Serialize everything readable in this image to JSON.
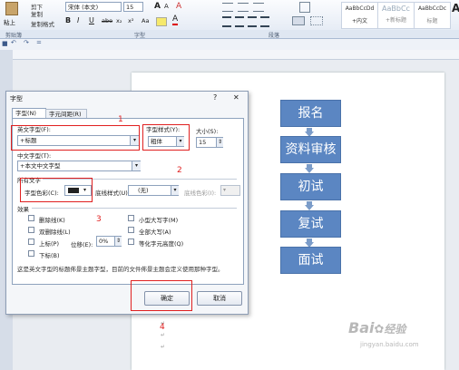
{
  "ribbon": {
    "paste_label": "粘上",
    "cut_label": "剪下",
    "copy_label": "复制",
    "format_painter_label": "复制格式",
    "font_name": "宋体 (本文)",
    "font_size": "15",
    "bold": "B",
    "italic": "I",
    "underline": "U",
    "strike": "abe",
    "subscript": "x₂",
    "superscript": "x²",
    "change_case": "Aa",
    "font_color_a": "A",
    "grow_font": "A",
    "shrink_font": "A",
    "clear_format": "A",
    "styles": [
      "AaBbCcDd",
      "AaBbCc",
      "AaBbCcDc",
      "A"
    ],
    "style_names": [
      "+内文",
      "+新标题",
      "标题",
      ""
    ],
    "groups": [
      "剪贴簿",
      "字型",
      "段落",
      ""
    ]
  },
  "qat": {
    "save": "■",
    "undo": "↶",
    "redo": "↷",
    "more": "="
  },
  "flow": {
    "steps": [
      "报名",
      "资料审核",
      "初试",
      "复试",
      "面试"
    ],
    "colors": {
      "box": "#5b86c2",
      "arrow": "#7b9cc9"
    }
  },
  "dialog": {
    "title": "字型",
    "help": "?",
    "close": "✕",
    "tabs": [
      "字型(N)",
      "字元间距(R)"
    ],
    "western_font_label": "英文字型(F):",
    "western_font_value": "+标题",
    "style_label": "字型样式(Y):",
    "style_value": "粗体",
    "size_label": "大小(S):",
    "size_value": "15",
    "asian_font_label": "中文字型(T):",
    "asian_font_value": "+本文中文字型",
    "all_text_label": "所有文字",
    "font_color_label": "字型色彩(C):",
    "underline_style_label": "底线样式(U):",
    "underline_style_value": "(无)",
    "underline_color_label": "底线色彩(I):",
    "effects_label": "效果",
    "effects_left": [
      "删除线(K)",
      "双删除线(L)",
      "上标(P)",
      "下标(B)"
    ],
    "effects_right": [
      "小型大写字(M)",
      "全部大写(A)",
      "等化字元高度(Q)"
    ],
    "offset_label": "位移(E):",
    "offset_value": "0%",
    "description": "这是英文字型的标题佈景主题字型，目前的文件佈景主题会定义使用那种字型。",
    "ok": "确定",
    "cancel": "取消",
    "annotations": [
      "1",
      "2",
      "3",
      "4"
    ],
    "annotation_color": "#e02020"
  },
  "watermark": {
    "brand": "Bai",
    "brand2": "经验",
    "url": "jingyan.baidu.com"
  }
}
